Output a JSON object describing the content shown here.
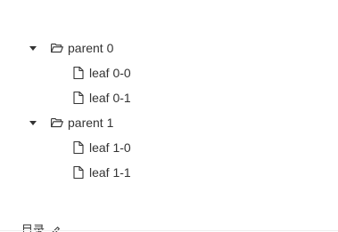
{
  "tree": {
    "nodes": [
      {
        "label": "parent 0",
        "type": "folder",
        "expanded": true,
        "level": 0,
        "icon": "folder-open-icon"
      },
      {
        "label": "leaf 0-0",
        "type": "file",
        "level": 1,
        "icon": "file-icon"
      },
      {
        "label": "leaf 0-1",
        "type": "file",
        "level": 1,
        "icon": "file-icon"
      },
      {
        "label": "parent 1",
        "type": "folder",
        "expanded": true,
        "level": 0,
        "icon": "folder-open-icon"
      },
      {
        "label": "leaf 1-0",
        "type": "file",
        "level": 1,
        "icon": "file-icon"
      },
      {
        "label": "leaf 1-1",
        "type": "file",
        "level": 1,
        "icon": "file-icon"
      }
    ]
  },
  "footer": {
    "text": "目录",
    "icon": "edit-icon"
  }
}
